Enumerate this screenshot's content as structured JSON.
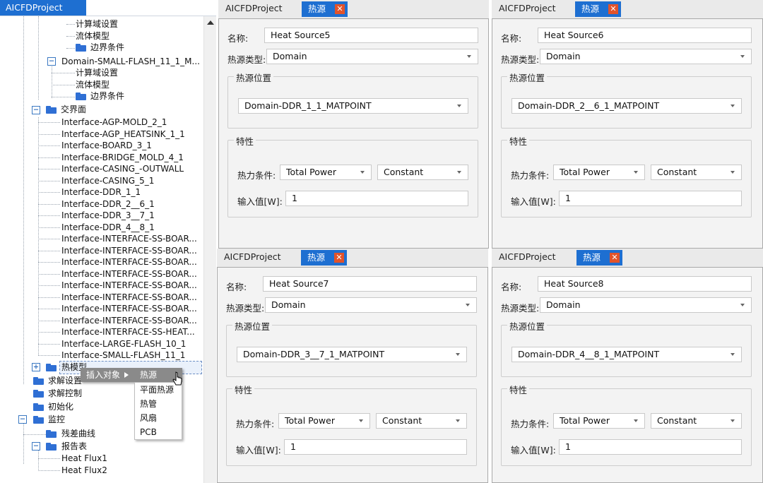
{
  "tree": {
    "header_tab": "AICFDProject",
    "rows": [
      {
        "label": "计算域设置"
      },
      {
        "label": "流体模型"
      },
      {
        "label": "边界条件"
      },
      {
        "label": "Domain-SMALL-FLASH_11_1_M..."
      },
      {
        "label": "计算域设置"
      },
      {
        "label": "流体模型"
      },
      {
        "label": "边界条件"
      },
      {
        "label": "交界面"
      },
      {
        "label": "Interface-AGP-MOLD_2_1"
      },
      {
        "label": "Interface-AGP_HEATSINK_1_1"
      },
      {
        "label": "Interface-BOARD_3_1"
      },
      {
        "label": "Interface-BRIDGE_MOLD_4_1"
      },
      {
        "label": "Interface-CASING_-OUTWALL"
      },
      {
        "label": "Interface-CASING_5_1"
      },
      {
        "label": "Interface-DDR_1_1"
      },
      {
        "label": "Interface-DDR_2__6_1"
      },
      {
        "label": "Interface-DDR_3__7_1"
      },
      {
        "label": "Interface-DDR_4__8_1"
      },
      {
        "label": "Interface-INTERFACE-SS-BOAR..."
      },
      {
        "label": "Interface-INTERFACE-SS-BOAR..."
      },
      {
        "label": "Interface-INTERFACE-SS-BOAR..."
      },
      {
        "label": "Interface-INTERFACE-SS-BOAR..."
      },
      {
        "label": "Interface-INTERFACE-SS-BOAR..."
      },
      {
        "label": "Interface-INTERFACE-SS-BOAR..."
      },
      {
        "label": "Interface-INTERFACE-SS-BOAR..."
      },
      {
        "label": "Interface-INTERFACE-SS-BOAR..."
      },
      {
        "label": "Interface-INTERFACE-SS-HEAT..."
      },
      {
        "label": "Interface-LARGE-FLASH_10_1"
      },
      {
        "label": "Interface-SMALL-FLASH_11_1"
      },
      {
        "label": "热模型"
      },
      {
        "label": "求解设置"
      },
      {
        "label": "求解控制"
      },
      {
        "label": "初始化"
      },
      {
        "label": "监控"
      },
      {
        "label": "残差曲线"
      },
      {
        "label": "报告表"
      },
      {
        "label": "Heat Flux1"
      },
      {
        "label": "Heat Flux2"
      }
    ]
  },
  "context_menu": {
    "item": "插入对象",
    "submenu_header": "热源",
    "submenu_items": [
      "平面热源",
      "热管",
      "风扇",
      "PCB"
    ]
  },
  "labels": {
    "name": "名称:",
    "type": "热源类型:",
    "location_group": "热源位置",
    "property_group": "特性",
    "thermal_condition": "热力条件:",
    "input_value": "输入值[W]:"
  },
  "panels": [
    {
      "title": "AICFDProject",
      "tab": "热源",
      "name_value": "Heat Source5",
      "type_value": "Domain",
      "location_value": "Domain-DDR_1_1_MATPOINT",
      "thermal_value": "Total Power",
      "mode_value": "Constant",
      "input_value": "1"
    },
    {
      "title": "AICFDProject",
      "tab": "热源",
      "name_value": "Heat Source6",
      "type_value": "Domain",
      "location_value": "Domain-DDR_2__6_1_MATPOINT",
      "thermal_value": "Total Power",
      "mode_value": "Constant",
      "input_value": "1"
    },
    {
      "title": "AICFDProject",
      "tab": "热源",
      "name_value": "Heat Source7",
      "type_value": "Domain",
      "location_value": "Domain-DDR_3__7_1_MATPOINT",
      "thermal_value": "Total Power",
      "mode_value": "Constant",
      "input_value": "1"
    },
    {
      "title": "AICFDProject",
      "tab": "热源",
      "name_value": "Heat Source8",
      "type_value": "Domain",
      "location_value": "Domain-DDR_4__8_1_MATPOINT",
      "thermal_value": "Total Power",
      "mode_value": "Constant",
      "input_value": "1"
    }
  ],
  "icons": {
    "close": "close-icon",
    "dropdown": "chevron-down-icon",
    "folder": "folder-icon",
    "expand": "expand-icon",
    "collapse": "collapse-icon",
    "cursor": "mouse-cursor-icon"
  },
  "colors": {
    "accent": "#1e6fd1",
    "close": "#e2532b",
    "folder": "#2f6fd4",
    "menu": "#8a8a8a"
  }
}
